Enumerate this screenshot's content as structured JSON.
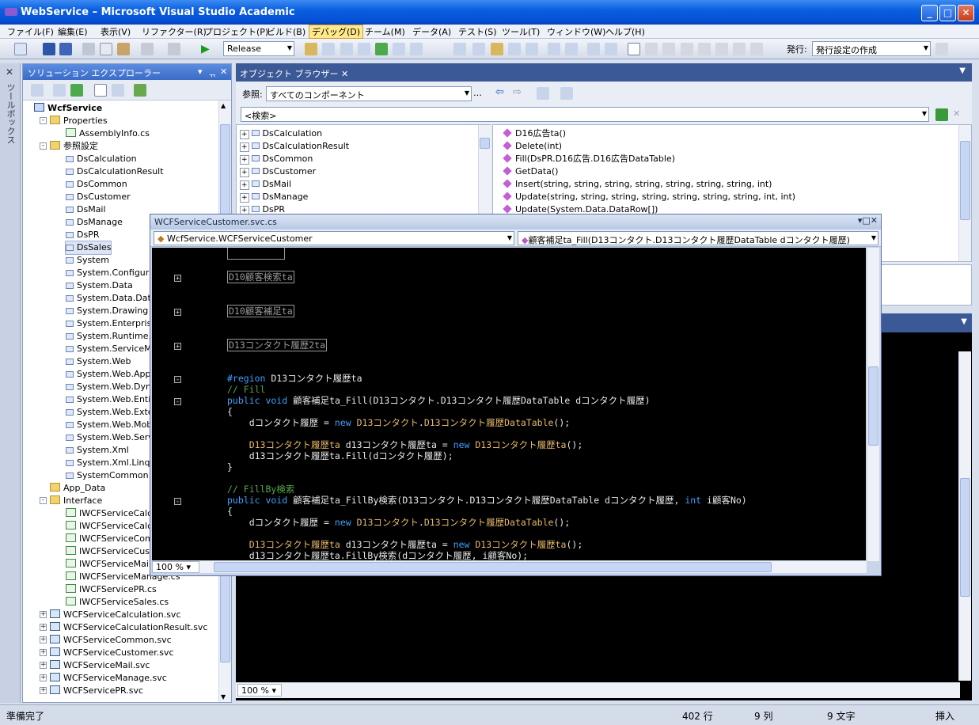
{
  "window": {
    "title": "WebService – Microsoft Visual Studio Academic"
  },
  "menu": [
    "ファイル(F)",
    "編集(E)",
    "表示(V)",
    "リファクター(R)",
    "プロジェクト(P)",
    "ビルド(B)",
    "デバッグ(D)",
    "チーム(M)",
    "データ(A)",
    "テスト(S)",
    "ツール(T)",
    "ウィンドウ(W)",
    "ヘルプ(H)"
  ],
  "toolbar": {
    "config": "Release",
    "publish_label": "発行:",
    "publish_value": "発行設定の作成"
  },
  "toolbox": {
    "label": "ツールボックス"
  },
  "solution_explorer": {
    "title": "ソリューション エクスプローラー",
    "items": [
      {
        "label": "WcfService",
        "indent": 0,
        "icon": "proj",
        "bold": true,
        "exp": ""
      },
      {
        "label": "Properties",
        "indent": 1,
        "icon": "folder",
        "exp": "-"
      },
      {
        "label": "AssemblyInfo.cs",
        "indent": 2,
        "icon": "cs",
        "exp": ""
      },
      {
        "label": "参照設定",
        "indent": 1,
        "icon": "folder",
        "exp": "-"
      },
      {
        "label": "DsCalculation",
        "indent": 2,
        "icon": "ref",
        "exp": ""
      },
      {
        "label": "DsCalculationResult",
        "indent": 2,
        "icon": "ref",
        "exp": ""
      },
      {
        "label": "DsCommon",
        "indent": 2,
        "icon": "ref",
        "exp": ""
      },
      {
        "label": "DsCustomer",
        "indent": 2,
        "icon": "ref",
        "exp": ""
      },
      {
        "label": "DsMail",
        "indent": 2,
        "icon": "ref",
        "exp": ""
      },
      {
        "label": "DsManage",
        "indent": 2,
        "icon": "ref",
        "exp": ""
      },
      {
        "label": "DsPR",
        "indent": 2,
        "icon": "ref",
        "exp": ""
      },
      {
        "label": "DsSales",
        "indent": 2,
        "icon": "ref",
        "exp": "",
        "selected": true
      },
      {
        "label": "System",
        "indent": 2,
        "icon": "ref",
        "exp": ""
      },
      {
        "label": "System.Configuration",
        "indent": 2,
        "icon": "ref",
        "exp": ""
      },
      {
        "label": "System.Data",
        "indent": 2,
        "icon": "ref",
        "exp": ""
      },
      {
        "label": "System.Data.DataSetExtensions",
        "indent": 2,
        "icon": "ref",
        "exp": ""
      },
      {
        "label": "System.Drawing",
        "indent": 2,
        "icon": "ref",
        "exp": ""
      },
      {
        "label": "System.EnterpriseServices",
        "indent": 2,
        "icon": "ref",
        "exp": ""
      },
      {
        "label": "System.Runtime.Serialization",
        "indent": 2,
        "icon": "ref",
        "exp": ""
      },
      {
        "label": "System.ServiceModel",
        "indent": 2,
        "icon": "ref",
        "exp": ""
      },
      {
        "label": "System.Web",
        "indent": 2,
        "icon": "ref",
        "exp": ""
      },
      {
        "label": "System.Web.ApplicationServices",
        "indent": 2,
        "icon": "ref",
        "exp": ""
      },
      {
        "label": "System.Web.DynamicData",
        "indent": 2,
        "icon": "ref",
        "exp": ""
      },
      {
        "label": "System.Web.Entity",
        "indent": 2,
        "icon": "ref",
        "exp": ""
      },
      {
        "label": "System.Web.Extensions",
        "indent": 2,
        "icon": "ref",
        "exp": ""
      },
      {
        "label": "System.Web.Mobile",
        "indent": 2,
        "icon": "ref",
        "exp": ""
      },
      {
        "label": "System.Web.Services",
        "indent": 2,
        "icon": "ref",
        "exp": ""
      },
      {
        "label": "System.Xml",
        "indent": 2,
        "icon": "ref",
        "exp": ""
      },
      {
        "label": "System.Xml.Linq",
        "indent": 2,
        "icon": "ref",
        "exp": ""
      },
      {
        "label": "SystemCommon",
        "indent": 2,
        "icon": "ref",
        "exp": ""
      },
      {
        "label": "App_Data",
        "indent": 1,
        "icon": "folder",
        "exp": ""
      },
      {
        "label": "Interface",
        "indent": 1,
        "icon": "folder",
        "exp": "-"
      },
      {
        "label": "IWCFServiceCalculation.cs",
        "indent": 2,
        "icon": "cs",
        "exp": ""
      },
      {
        "label": "IWCFServiceCalculationResult.cs",
        "indent": 2,
        "icon": "cs",
        "exp": ""
      },
      {
        "label": "IWCFServiceCommon.cs",
        "indent": 2,
        "icon": "cs",
        "exp": ""
      },
      {
        "label": "IWCFServiceCustomer.cs",
        "indent": 2,
        "icon": "cs",
        "exp": ""
      },
      {
        "label": "IWCFServiceMail.cs",
        "indent": 2,
        "icon": "cs",
        "exp": ""
      },
      {
        "label": "IWCFServiceManage.cs",
        "indent": 2,
        "icon": "cs",
        "exp": ""
      },
      {
        "label": "IWCFServicePR.cs",
        "indent": 2,
        "icon": "cs",
        "exp": ""
      },
      {
        "label": "IWCFServiceSales.cs",
        "indent": 2,
        "icon": "cs",
        "exp": ""
      },
      {
        "label": "WCFServiceCalculation.svc",
        "indent": 1,
        "icon": "svc",
        "exp": "+"
      },
      {
        "label": "WCFServiceCalculationResult.svc",
        "indent": 1,
        "icon": "svc",
        "exp": "+"
      },
      {
        "label": "WCFServiceCommon.svc",
        "indent": 1,
        "icon": "svc",
        "exp": "+"
      },
      {
        "label": "WCFServiceCustomer.svc",
        "indent": 1,
        "icon": "svc",
        "exp": "+"
      },
      {
        "label": "WCFServiceMail.svc",
        "indent": 1,
        "icon": "svc",
        "exp": "+"
      },
      {
        "label": "WCFServiceManage.svc",
        "indent": 1,
        "icon": "svc",
        "exp": "+"
      },
      {
        "label": "WCFServicePR.svc",
        "indent": 1,
        "icon": "svc",
        "exp": "+"
      }
    ]
  },
  "object_browser": {
    "tab": "オブジェクト ブラウザー",
    "browse_label": "参照:",
    "browse_value": "すべてのコンポーネント",
    "search_value": "<検索>",
    "left_items": [
      "DsCalculation",
      "DsCalculationResult",
      "DsCommon",
      "DsCustomer",
      "DsMail",
      "DsManage",
      "DsPR"
    ],
    "right_items": [
      "D16広告ta()",
      "Delete(int)",
      "Fill(DsPR.D16広告.D16広告DataTable)",
      "GetData()",
      "Insert(string, string, string, string, string, string, string, int)",
      "Update(string, string, string, string, string, string, string, int, int)",
      "Update(System.Data.DataRow[])"
    ]
  },
  "editor": {
    "title": "WCFServiceCustomer.svc.cs",
    "class_combo": "WcfService.WCFServiceCustomer",
    "member_combo": "顧客補足ta_Fill(D13コンタクト.D13コンタクト履歴DataTable dコンタクト履歴)",
    "zoom": "100 %"
  },
  "lower_zoom": "100 %",
  "status": {
    "ready": "準備完了",
    "line": "402 行",
    "col": "9 列",
    "ch": "9 文字",
    "mode": "挿入"
  }
}
